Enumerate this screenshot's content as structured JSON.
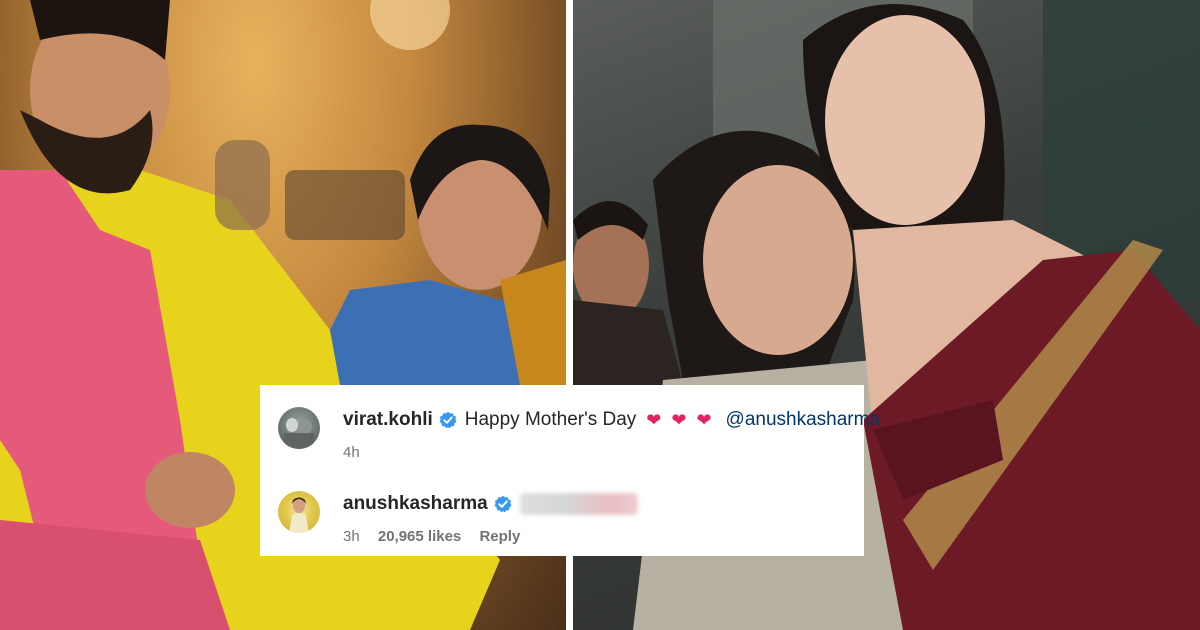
{
  "comments": [
    {
      "username": "virat.kohli",
      "text": "Happy Mother's Day",
      "hearts": "❤❤❤",
      "mention": "@anushkasharma",
      "time": "4h"
    },
    {
      "username": "anushkasharma",
      "time": "3h",
      "likes": "20,965 likes",
      "reply": "Reply"
    }
  ],
  "colors": {
    "verified": "#3897f0",
    "heart": "#e0245e",
    "mention": "#00376b",
    "meta": "#737373"
  }
}
